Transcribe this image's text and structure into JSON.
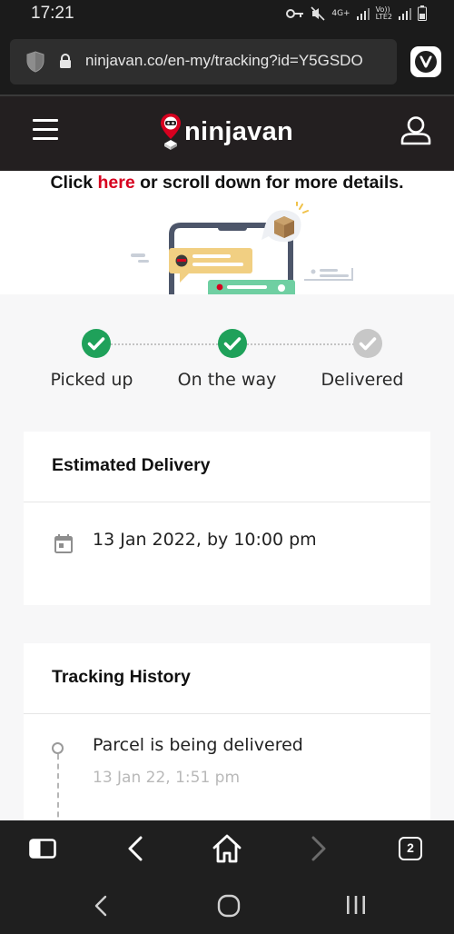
{
  "status_bar": {
    "time": "17:21",
    "icons": [
      "key-icon",
      "mute-icon",
      "4g-signal-icon",
      "volte-signal-icon",
      "battery-icon"
    ],
    "net_label": "4G+",
    "volte_label": "Vo))\nLTE2"
  },
  "browser": {
    "url": "ninjavan.co/en-my/tracking?id=Y5GSDO",
    "tabs_count": "2"
  },
  "site": {
    "brand": "ninjavan"
  },
  "hero": {
    "prefix": "Click ",
    "link": "here",
    "suffix": " or scroll down for more details."
  },
  "progress": {
    "steps": [
      {
        "label": "Picked up",
        "done": true
      },
      {
        "label": "On the way",
        "done": true
      },
      {
        "label": "Delivered",
        "done": false
      }
    ]
  },
  "estimated": {
    "title": "Estimated Delivery",
    "value": "13 Jan 2022, by 10:00 pm"
  },
  "history": {
    "title": "Tracking History",
    "items": [
      {
        "event": "Parcel is being delivered",
        "time": "13 Jan 22, 1:51 pm"
      }
    ]
  },
  "colors": {
    "accent_red": "#d7001f",
    "success_green": "#1fa15a",
    "pending_gray": "#c7c7c7",
    "header_dark": "#231f20"
  }
}
